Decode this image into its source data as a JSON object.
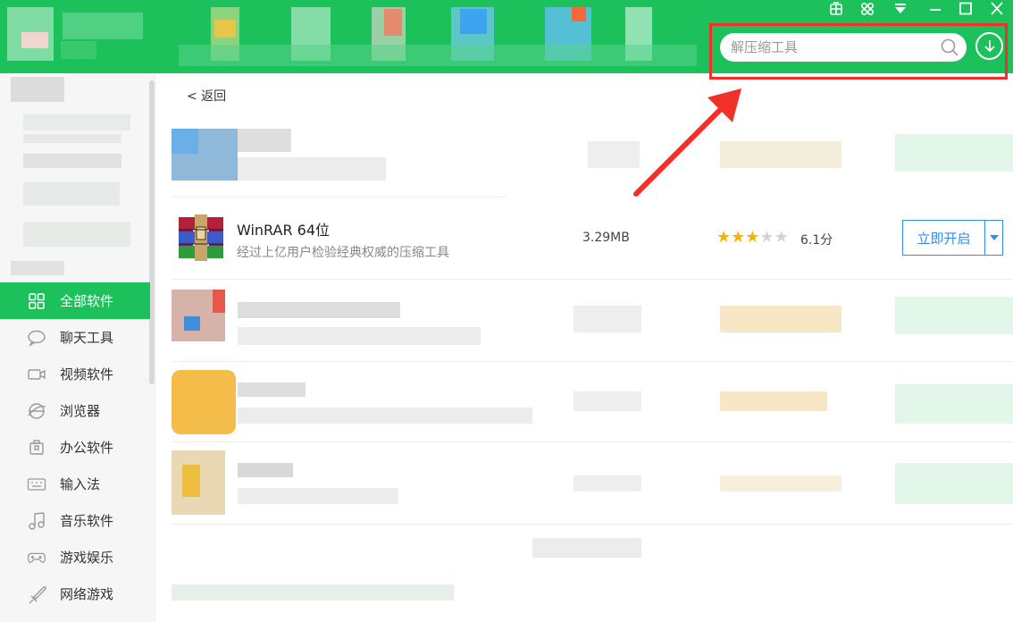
{
  "header": {
    "search_placeholder": "解压缩工具",
    "window_controls": [
      "skin-icon",
      "settings-icon",
      "menu-icon",
      "minimize-icon",
      "maximize-icon",
      "close-icon"
    ]
  },
  "sidebar": {
    "categories": [
      {
        "label": "全部软件",
        "icon": "grid-icon",
        "active": true
      },
      {
        "label": "聊天工具",
        "icon": "chat-bubble-icon"
      },
      {
        "label": "视频软件",
        "icon": "video-camera-icon"
      },
      {
        "label": "浏览器",
        "icon": "browser-icon"
      },
      {
        "label": "办公软件",
        "icon": "briefcase-icon"
      },
      {
        "label": "输入法",
        "icon": "keyboard-icon"
      },
      {
        "label": "音乐软件",
        "icon": "music-note-icon"
      },
      {
        "label": "游戏娱乐",
        "icon": "gamepad-icon"
      },
      {
        "label": "网络游戏",
        "icon": "sword-icon"
      }
    ]
  },
  "main": {
    "back_label": "< 返回",
    "featured_app": {
      "name": "WinRAR 64位",
      "description": "经过上亿用户检验经典权威的压缩工具",
      "size": "3.29MB",
      "stars": 3,
      "max_stars": 5,
      "rating": "6.1分",
      "action_label": "立即开启"
    }
  },
  "colors": {
    "brand_green": "#1dc15c",
    "highlight_red": "#f2302a",
    "action_blue": "#2f8ee5",
    "star_gold": "#f5b400"
  }
}
